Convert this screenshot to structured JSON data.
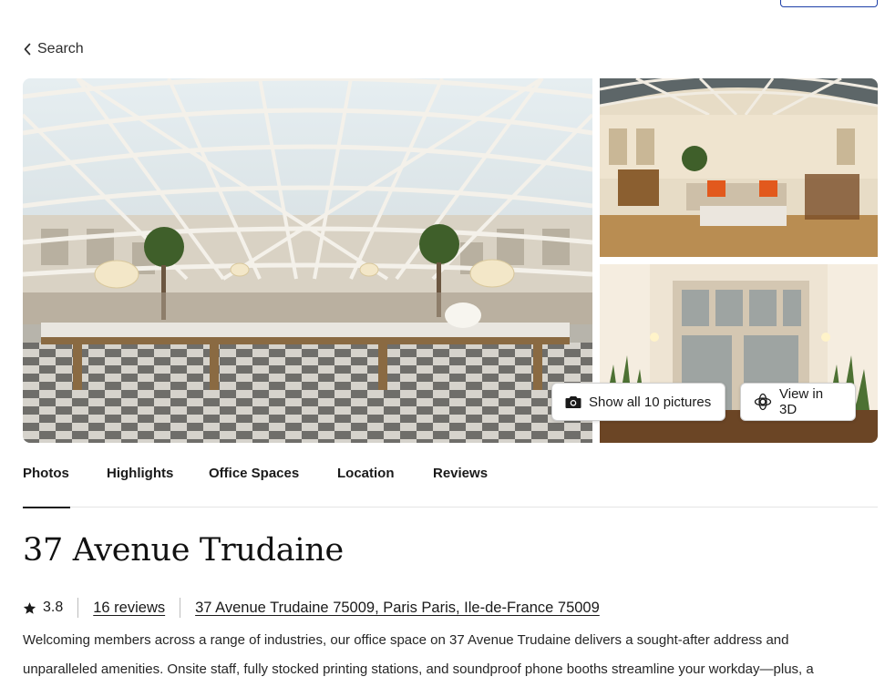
{
  "nav": {
    "back_label": "Search"
  },
  "gallery": {
    "show_all_label": "Show all 10 pictures",
    "view_3d_label": "View in 3D"
  },
  "tabs": [
    {
      "label": "Photos",
      "active": true
    },
    {
      "label": "Highlights",
      "active": false
    },
    {
      "label": "Office Spaces",
      "active": false
    },
    {
      "label": "Location",
      "active": false
    },
    {
      "label": "Reviews",
      "active": false
    }
  ],
  "listing": {
    "title": "37 Avenue Trudaine",
    "rating": "3.8",
    "reviews_label": "16 reviews",
    "address": "37 Avenue Trudaine 75009, Paris Paris, Ile-de-France 75009",
    "description": "Welcoming members across a range of industries, our office space on 37 Avenue Trudaine delivers a sought-after address and unparalleled amenities. Onsite staff, fully stocked printing stations, and soundproof phone booths streamline your workday—plus, a"
  },
  "icons": {
    "back": "chevron-left-icon",
    "camera": "camera-icon",
    "view3d": "3d-view-icon",
    "star": "star-icon"
  },
  "colors": {
    "accent_border": "#1d3fa8",
    "text": "#1a1a1a",
    "divider": "#e4e4e4"
  }
}
